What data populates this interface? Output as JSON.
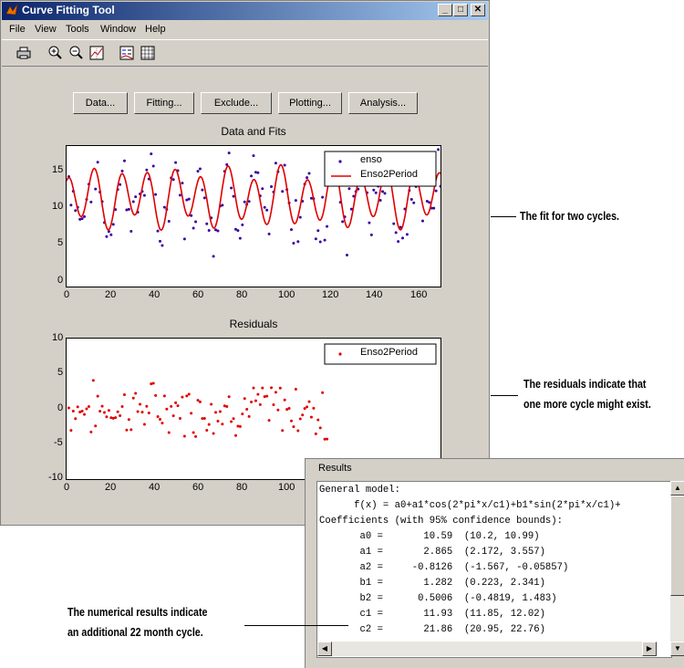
{
  "window": {
    "title": "Curve Fitting Tool"
  },
  "menu": [
    "File",
    "View",
    "Tools",
    "Window",
    "Help"
  ],
  "toolbar_icons": [
    "print-icon",
    "zoom-in-icon",
    "zoom-out-icon",
    "data-cursor-icon",
    "legend-icon",
    "grid-icon"
  ],
  "buttons": [
    "Data...",
    "Fitting...",
    "Exclude...",
    "Plotting...",
    "Analysis..."
  ],
  "plot1": {
    "title": "Data and Fits",
    "legend": [
      "enso",
      "Enso2Period"
    ],
    "yticks": [
      "15",
      "10",
      "5",
      "0"
    ],
    "xticks": [
      "0",
      "20",
      "40",
      "60",
      "80",
      "100",
      "120",
      "140",
      "160"
    ],
    "colors": {
      "data": "#3a00a0",
      "fit": "#e00000"
    }
  },
  "plot2": {
    "title": "Residuals",
    "legend": [
      "Enso2Period"
    ],
    "yticks": [
      "10",
      "5",
      "0",
      "-5",
      "-10"
    ],
    "xticks": [
      "0",
      "20",
      "40",
      "60",
      "80",
      "100"
    ],
    "colors": {
      "resid": "#e00000"
    }
  },
  "results": {
    "label": "Results",
    "lines": [
      "General model:",
      "      f(x) = a0+a1*cos(2*pi*x/c1)+b1*sin(2*pi*x/c1)+",
      "Coefficients (with 95% confidence bounds):",
      "       a0 =       10.59  (10.2, 10.99)",
      "       a1 =       2.865  (2.172, 3.557)",
      "       a2 =     -0.8126  (-1.567, -0.05857)",
      "       b1 =       1.282  (0.223, 2.341)",
      "       b2 =      0.5006  (-0.4819, 1.483)",
      "       c1 =       11.93  (11.85, 12.02)",
      "       c2 =       21.86  (20.95, 22.76)"
    ]
  },
  "callouts": {
    "fit": "The fit for two cycles.",
    "resid1": "The residuals indicate that",
    "resid2": "one more cycle might exist.",
    "num1": "The numerical results indicate",
    "num2": "an additional 22 month cycle."
  }
}
